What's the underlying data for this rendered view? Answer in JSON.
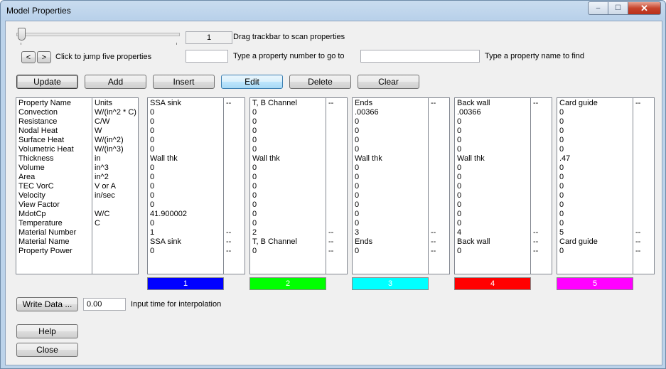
{
  "window": {
    "title": "Model Properties",
    "min": "‒",
    "max": "☐",
    "close": "✕"
  },
  "trackbar": {
    "value": "1",
    "label": "Drag trackbar to scan properties"
  },
  "nav": {
    "prev": "<",
    "next": ">",
    "label": "Click to jump five properties"
  },
  "goto": {
    "value": "",
    "label": "Type a property number to go to"
  },
  "find": {
    "value": "",
    "label": "Type a property name to find"
  },
  "buttons": {
    "update": "Update",
    "add": "Add",
    "insert": "Insert",
    "edit": "Edit",
    "delete": "Delete",
    "clear": "Clear"
  },
  "names_panel": {
    "names": [
      "Property Name",
      "Convection",
      "Resistance",
      "Nodal Heat",
      "Surface Heat",
      "Volumetric Heat",
      "Thickness",
      "Volume",
      "Area",
      "TEC VorC",
      "Velocity",
      "View Factor",
      "MdotCp",
      "Temperature",
      "Material Number",
      "Material Name",
      "Property Power"
    ],
    "units": [
      "Units",
      "W/(in^2 * C)",
      "C/W",
      "W",
      "W/(in^2)",
      "W/(in^3)",
      "in",
      "in^3",
      "in^2",
      "V or A",
      "in/sec",
      "",
      "W/C",
      "C",
      "",
      "",
      ""
    ]
  },
  "properties": [
    {
      "values": [
        "SSA sink",
        " 0",
        " 0",
        " 0",
        " 0",
        " 0",
        "Wall thk",
        " 0",
        " 0",
        " 0",
        " 0",
        " 0",
        " 41.900002",
        " 0",
        " 1",
        "SSA sink",
        " 0"
      ],
      "flags": [
        "--",
        "",
        "",
        "",
        "",
        "",
        "",
        "",
        "",
        "",
        "",
        "",
        "",
        "",
        "--",
        "--",
        "--"
      ],
      "swatch": {
        "color": "#0000ff",
        "label": "1"
      }
    },
    {
      "values": [
        "T, B Channel",
        " 0",
        " 0",
        " 0",
        " 0",
        " 0",
        "Wall thk",
        " 0",
        " 0",
        " 0",
        " 0",
        " 0",
        " 0",
        " 0",
        " 2",
        "T, B Channel",
        " 0"
      ],
      "flags": [
        "--",
        "",
        "",
        "",
        "",
        "",
        "",
        "",
        "",
        "",
        "",
        "",
        "",
        "",
        "--",
        "--",
        "--"
      ],
      "swatch": {
        "color": "#00ff00",
        "label": "2"
      }
    },
    {
      "values": [
        "Ends",
        " .00366",
        " 0",
        " 0",
        " 0",
        " 0",
        "Wall thk",
        " 0",
        " 0",
        " 0",
        " 0",
        " 0",
        " 0",
        " 0",
        " 3",
        "Ends",
        " 0"
      ],
      "flags": [
        "--",
        "",
        "",
        "",
        "",
        "",
        "",
        "",
        "",
        "",
        "",
        "",
        "",
        "",
        "--",
        "--",
        "--"
      ],
      "swatch": {
        "color": "#00ffff",
        "label": "3"
      }
    },
    {
      "values": [
        "Back wall",
        " .00366",
        " 0",
        " 0",
        " 0",
        " 0",
        "Wall thk",
        " 0",
        " 0",
        " 0",
        " 0",
        " 0",
        " 0",
        " 0",
        " 4",
        "Back wall",
        " 0"
      ],
      "flags": [
        "--",
        "",
        "",
        "",
        "",
        "",
        "",
        "",
        "",
        "",
        "",
        "",
        "",
        "",
        "--",
        "--",
        "--"
      ],
      "swatch": {
        "color": "#ff0000",
        "label": "4"
      }
    },
    {
      "values": [
        "Card guide",
        " 0",
        " 0",
        " 0",
        " 0",
        " 0",
        " .47",
        " 0",
        " 0",
        " 0",
        " 0",
        " 0",
        " 0",
        " 0",
        " 5",
        "Card guide",
        " 0"
      ],
      "flags": [
        "--",
        "",
        "",
        "",
        "",
        "",
        "",
        "",
        "",
        "",
        "",
        "",
        "",
        "",
        "--",
        "--",
        "--"
      ],
      "swatch": {
        "color": "#ff00ff",
        "label": "5"
      }
    }
  ],
  "write": {
    "button": "Write Data ...",
    "time_value": "0.00",
    "label": "Input time for interpolation"
  },
  "help": "Help",
  "close_btn": "Close"
}
